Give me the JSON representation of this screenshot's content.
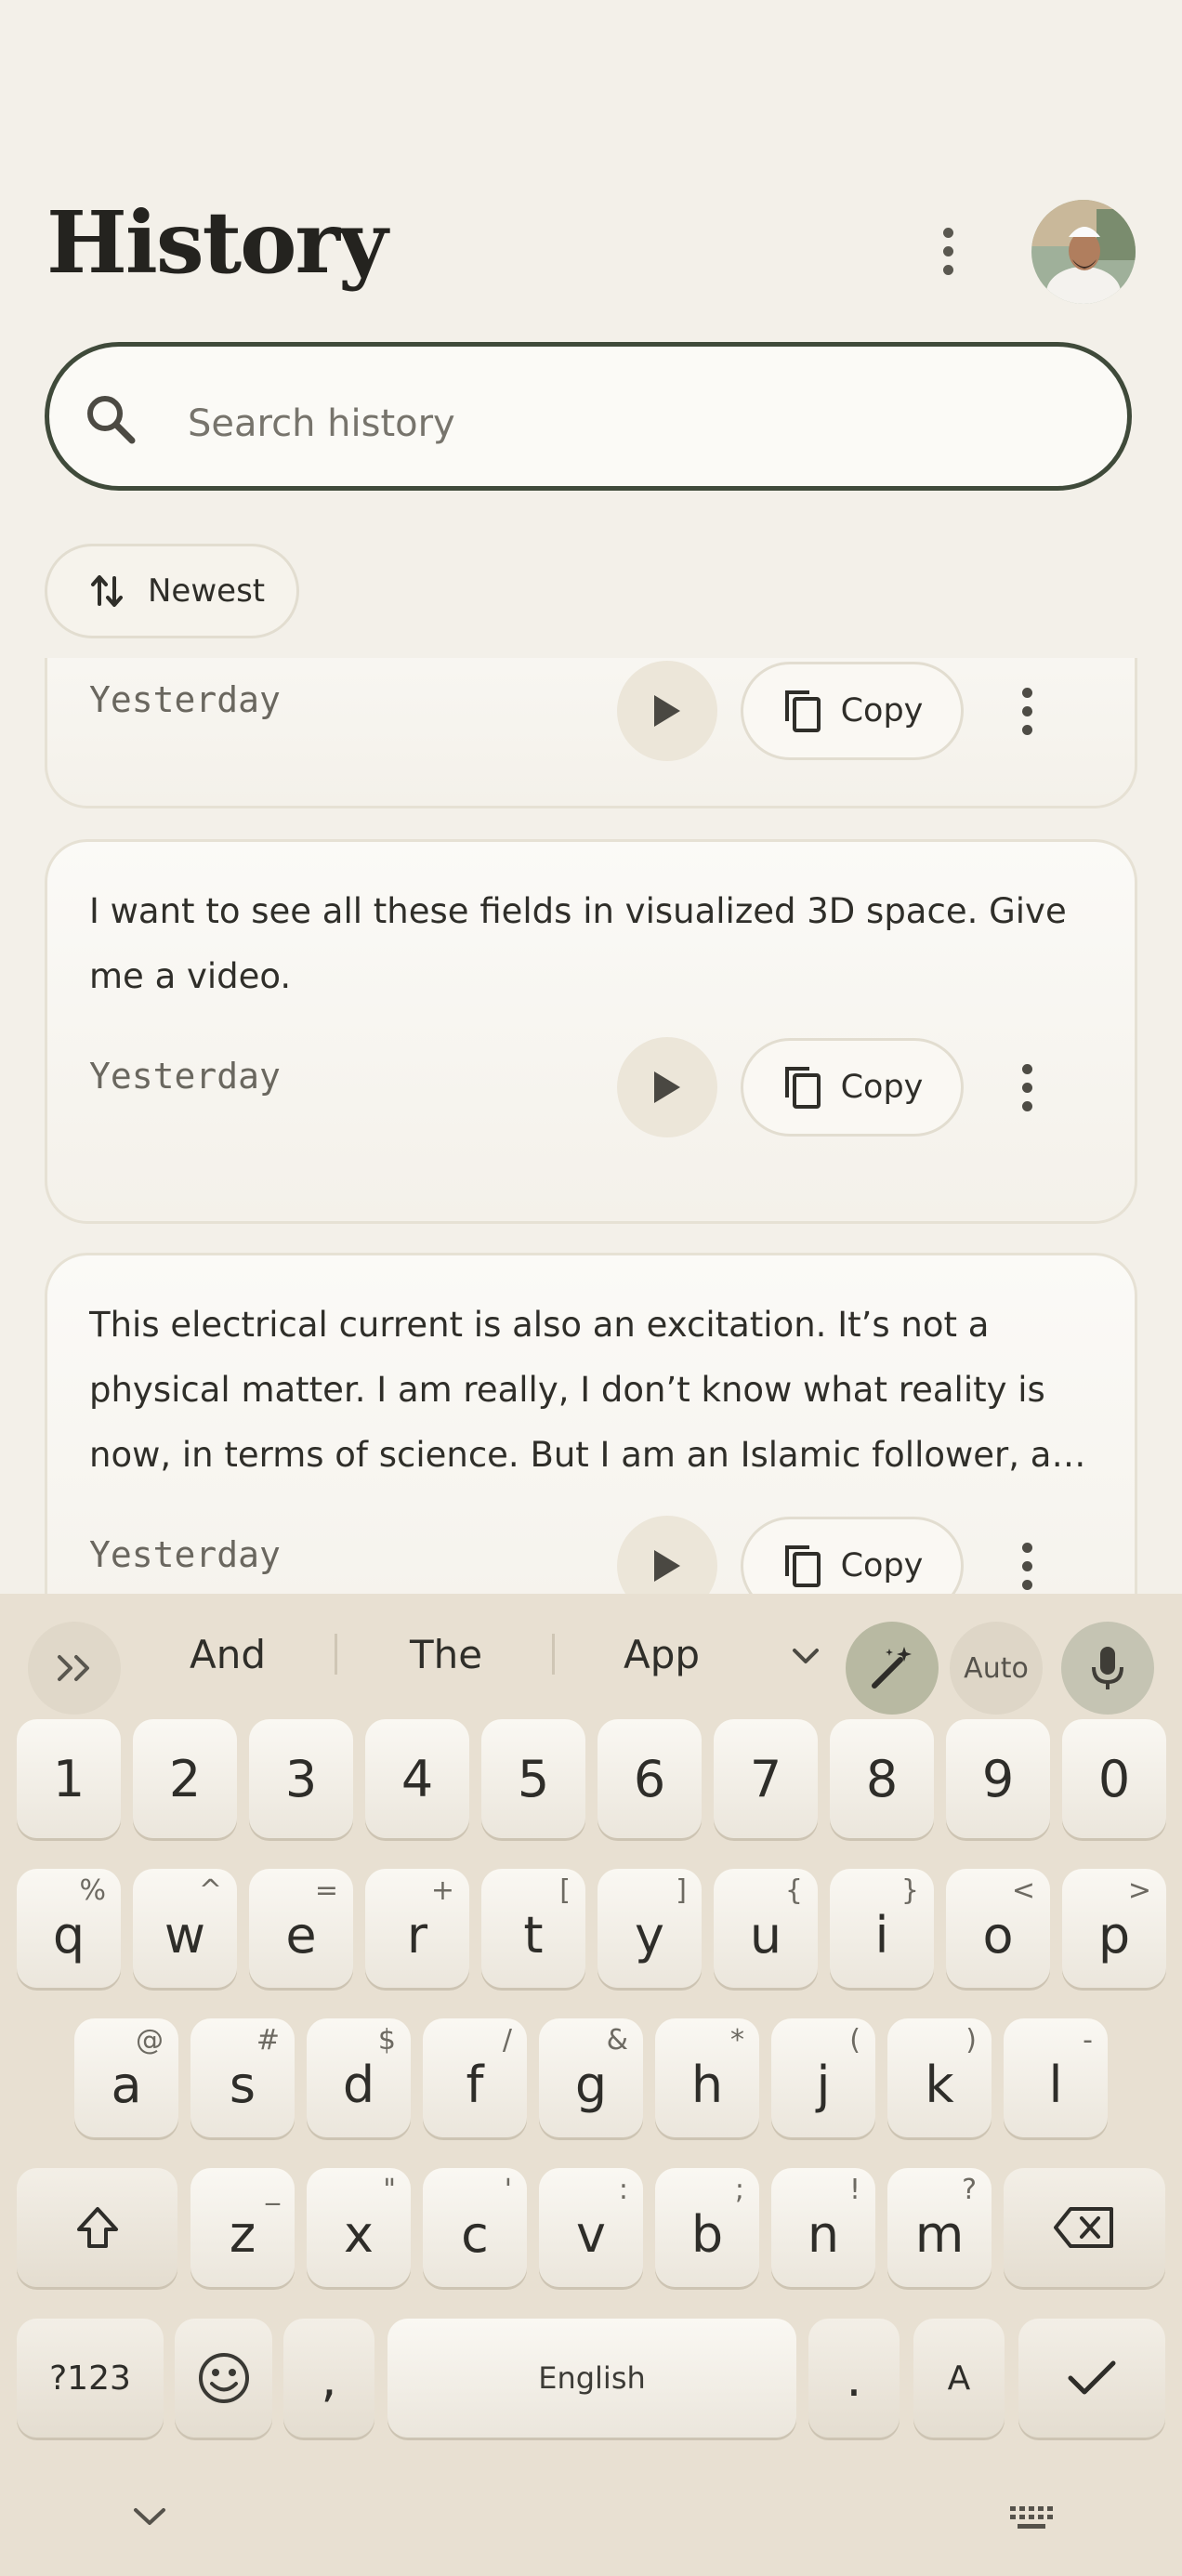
{
  "header": {
    "title": "History"
  },
  "search": {
    "placeholder": "Search history"
  },
  "sort": {
    "label": "Newest"
  },
  "cards": [
    {
      "text": "",
      "date": "Yesterday",
      "copy_label": "Copy"
    },
    {
      "text": "I want to see all these fields in visualized 3D space. Give me a video.",
      "date": "Yesterday",
      "copy_label": "Copy"
    },
    {
      "text": "This electrical current is also an excitation. It’s not a physical matter. I am really, I don’t know what reality is now, in terms of science. But I am an Islamic follower, a…",
      "date": "Yesterday",
      "copy_label": "Copy"
    }
  ],
  "keyboard": {
    "suggestions": [
      "And",
      "The",
      "App"
    ],
    "auto_label": "Auto",
    "number_row": [
      "1",
      "2",
      "3",
      "4",
      "5",
      "6",
      "7",
      "8",
      "9",
      "0"
    ],
    "row1": [
      {
        "k": "q",
        "h": "%"
      },
      {
        "k": "w",
        "h": "^"
      },
      {
        "k": "e",
        "h": "="
      },
      {
        "k": "r",
        "h": "+"
      },
      {
        "k": "t",
        "h": "["
      },
      {
        "k": "y",
        "h": "]"
      },
      {
        "k": "u",
        "h": "{"
      },
      {
        "k": "i",
        "h": "}"
      },
      {
        "k": "o",
        "h": "<"
      },
      {
        "k": "p",
        "h": ">"
      }
    ],
    "row2": [
      {
        "k": "a",
        "h": "@"
      },
      {
        "k": "s",
        "h": "#"
      },
      {
        "k": "d",
        "h": "$"
      },
      {
        "k": "f",
        "h": "/"
      },
      {
        "k": "g",
        "h": "&"
      },
      {
        "k": "h",
        "h": "*"
      },
      {
        "k": "j",
        "h": "("
      },
      {
        "k": "k",
        "h": ")"
      },
      {
        "k": "l",
        "h": "-"
      }
    ],
    "row3": [
      {
        "k": "z",
        "h": "_"
      },
      {
        "k": "x",
        "h": "\""
      },
      {
        "k": "c",
        "h": "'"
      },
      {
        "k": "v",
        "h": ":"
      },
      {
        "k": "b",
        "h": ";"
      },
      {
        "k": "n",
        "h": "!"
      },
      {
        "k": "m",
        "h": "?"
      }
    ],
    "symbols_label": "?123",
    "comma": ",",
    "space_label": "English",
    "period": ".",
    "lang_label": "A"
  },
  "colors": {
    "accent": "#3f4a3a",
    "background": "#f3f0e9",
    "keyboard_bg": "#e8e0d2"
  }
}
